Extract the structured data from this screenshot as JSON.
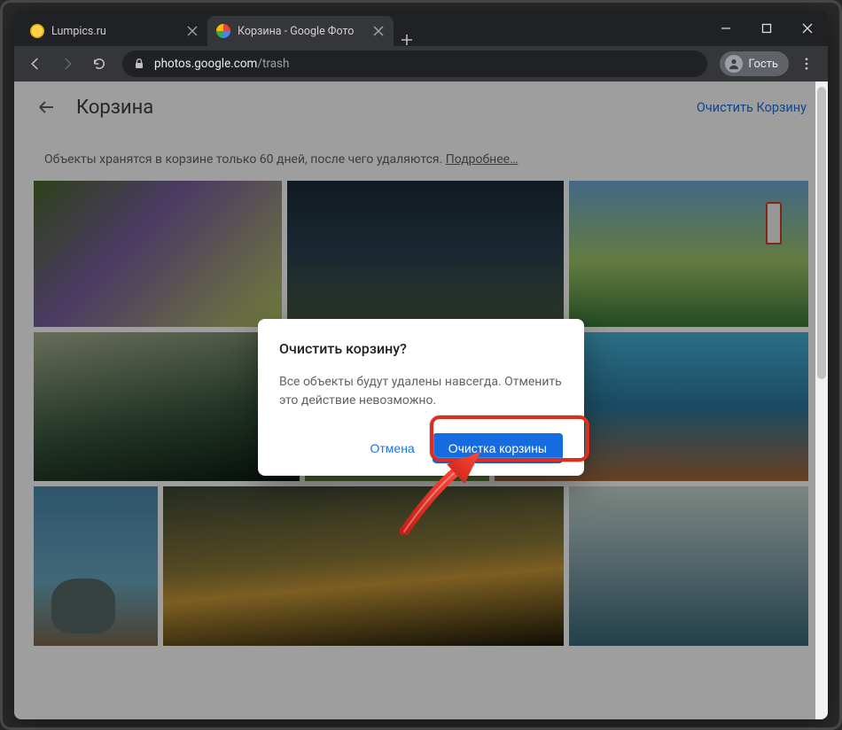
{
  "window": {
    "tabs": [
      {
        "label": "Lumpics.ru",
        "favicon": "yellow-dot",
        "active": false
      },
      {
        "label": "Корзина - Google Фото",
        "favicon": "google-photos",
        "active": true
      }
    ],
    "url_domain": "photos.google.com",
    "url_path": "/trash",
    "guest_label": "Гость"
  },
  "header": {
    "title": "Корзина",
    "clear_action": "Очистить Корзину"
  },
  "notice": {
    "text": "Объекты хранятся в корзине только 60 дней, после чего удаляются. ",
    "link": "Подробнее…"
  },
  "dialog": {
    "title": "Очистить корзину?",
    "body": "Все объекты будут удалены навсегда. Отменить это действие невозможно.",
    "cancel": "Отмена",
    "confirm": "Очистка корзины"
  }
}
